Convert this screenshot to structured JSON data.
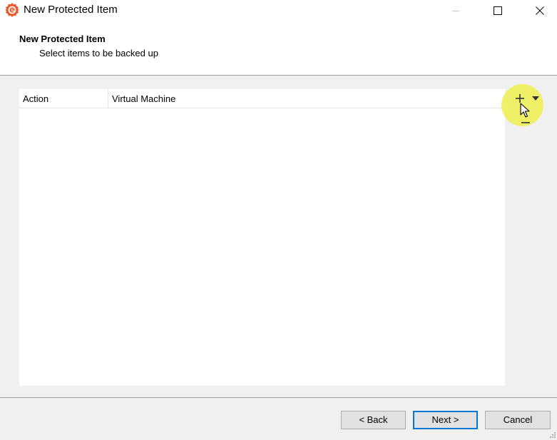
{
  "window": {
    "title": "New Protected Item",
    "icon": "app-logo-icon",
    "controls": [
      "minimize-icon",
      "maximize-icon",
      "close-icon"
    ]
  },
  "header": {
    "title": "New Protected Item",
    "subtitle": "Select items to be backed up"
  },
  "list": {
    "columns": [
      "Action",
      "Virtual Machine"
    ],
    "rows": []
  },
  "tools": {
    "add": "plus-icon",
    "dropdown": "caret-down-icon",
    "remove": "minus-icon"
  },
  "buttons": {
    "back": "< Back",
    "next": "Next >",
    "cancel": "Cancel"
  },
  "colors": {
    "accent": "#0078d7",
    "logo": "#e8562a",
    "highlight": "#f0f050"
  }
}
